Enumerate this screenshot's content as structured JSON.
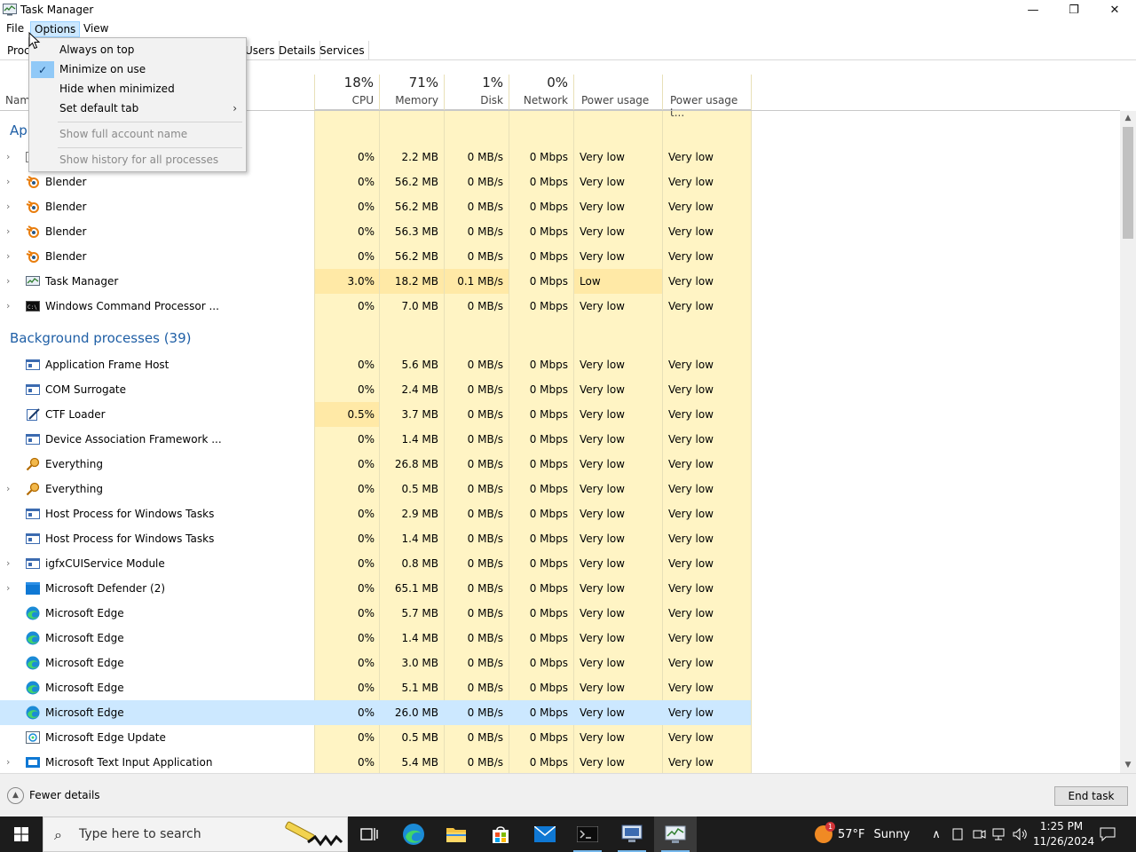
{
  "window": {
    "title": "Task Manager",
    "controls": {
      "minimize": "—",
      "maximize": "❐",
      "close": "✕"
    }
  },
  "menubar": {
    "file": "File",
    "options": "Options",
    "view": "View"
  },
  "tabs": {
    "processes": "Proc",
    "users": "Users",
    "details": "Details",
    "services": "Services"
  },
  "columns": {
    "name": "Nam",
    "cpu": {
      "pct": "18%",
      "label": "CPU"
    },
    "memory": {
      "pct": "71%",
      "label": "Memory"
    },
    "disk": {
      "pct": "1%",
      "label": "Disk"
    },
    "network": {
      "pct": "0%",
      "label": "Network"
    },
    "power": {
      "label": "Power usage"
    },
    "power_trend": {
      "label": "Power usage t..."
    }
  },
  "groups": {
    "apps": "App",
    "background": "Background processes (39)"
  },
  "apps_rows": [
    {
      "name": "",
      "icon": "app-icon",
      "expander": true,
      "cpu": "0%",
      "mem": "2.2 MB",
      "disk": "0 MB/s",
      "net": "0 Mbps",
      "power": "Very low",
      "trend": "Very low"
    },
    {
      "name": "Blender",
      "icon": "blender-icon",
      "expander": true,
      "cpu": "0%",
      "mem": "56.2 MB",
      "disk": "0 MB/s",
      "net": "0 Mbps",
      "power": "Very low",
      "trend": "Very low"
    },
    {
      "name": "Blender",
      "icon": "blender-icon",
      "expander": true,
      "cpu": "0%",
      "mem": "56.2 MB",
      "disk": "0 MB/s",
      "net": "0 Mbps",
      "power": "Very low",
      "trend": "Very low"
    },
    {
      "name": "Blender",
      "icon": "blender-icon",
      "expander": true,
      "cpu": "0%",
      "mem": "56.3 MB",
      "disk": "0 MB/s",
      "net": "0 Mbps",
      "power": "Very low",
      "trend": "Very low"
    },
    {
      "name": "Blender",
      "icon": "blender-icon",
      "expander": true,
      "cpu": "0%",
      "mem": "56.2 MB",
      "disk": "0 MB/s",
      "net": "0 Mbps",
      "power": "Very low",
      "trend": "Very low"
    },
    {
      "name": "Task Manager",
      "icon": "task-manager-icon",
      "expander": true,
      "cpu": "3.0%",
      "mem": "18.2 MB",
      "disk": "0.1 MB/s",
      "net": "0 Mbps",
      "power": "Low",
      "trend": "Very low",
      "hot": true
    },
    {
      "name": "Windows Command Processor ...",
      "icon": "cmd-icon",
      "expander": true,
      "cpu": "0%",
      "mem": "7.0 MB",
      "disk": "0 MB/s",
      "net": "0 Mbps",
      "power": "Very low",
      "trend": "Very low"
    }
  ],
  "bg_rows": [
    {
      "name": "Application Frame Host",
      "icon": "window-icon",
      "expander": false,
      "cpu": "0%",
      "mem": "5.6 MB",
      "disk": "0 MB/s",
      "net": "0 Mbps",
      "power": "Very low",
      "trend": "Very low"
    },
    {
      "name": "COM Surrogate",
      "icon": "window-icon",
      "expander": false,
      "cpu": "0%",
      "mem": "2.4 MB",
      "disk": "0 MB/s",
      "net": "0 Mbps",
      "power": "Very low",
      "trend": "Very low"
    },
    {
      "name": "CTF Loader",
      "icon": "ctf-icon",
      "expander": false,
      "cpu": "0.5%",
      "mem": "3.7 MB",
      "disk": "0 MB/s",
      "net": "0 Mbps",
      "power": "Very low",
      "trend": "Very low",
      "cpuhot": true
    },
    {
      "name": "Device Association Framework ...",
      "icon": "window-icon",
      "expander": false,
      "cpu": "0%",
      "mem": "1.4 MB",
      "disk": "0 MB/s",
      "net": "0 Mbps",
      "power": "Very low",
      "trend": "Very low"
    },
    {
      "name": "Everything",
      "icon": "everything-icon",
      "expander": false,
      "cpu": "0%",
      "mem": "26.8 MB",
      "disk": "0 MB/s",
      "net": "0 Mbps",
      "power": "Very low",
      "trend": "Very low"
    },
    {
      "name": "Everything",
      "icon": "everything-icon",
      "expander": true,
      "cpu": "0%",
      "mem": "0.5 MB",
      "disk": "0 MB/s",
      "net": "0 Mbps",
      "power": "Very low",
      "trend": "Very low"
    },
    {
      "name": "Host Process for Windows Tasks",
      "icon": "window-icon",
      "expander": false,
      "cpu": "0%",
      "mem": "2.9 MB",
      "disk": "0 MB/s",
      "net": "0 Mbps",
      "power": "Very low",
      "trend": "Very low"
    },
    {
      "name": "Host Process for Windows Tasks",
      "icon": "window-icon",
      "expander": false,
      "cpu": "0%",
      "mem": "1.4 MB",
      "disk": "0 MB/s",
      "net": "0 Mbps",
      "power": "Very low",
      "trend": "Very low"
    },
    {
      "name": "igfxCUIService Module",
      "icon": "window-icon",
      "expander": true,
      "cpu": "0%",
      "mem": "0.8 MB",
      "disk": "0 MB/s",
      "net": "0 Mbps",
      "power": "Very low",
      "trend": "Very low"
    },
    {
      "name": "Microsoft Defender (2)",
      "icon": "defender-icon",
      "expander": true,
      "cpu": "0%",
      "mem": "65.1 MB",
      "disk": "0 MB/s",
      "net": "0 Mbps",
      "power": "Very low",
      "trend": "Very low"
    },
    {
      "name": "Microsoft Edge",
      "icon": "edge-icon",
      "expander": false,
      "cpu": "0%",
      "mem": "5.7 MB",
      "disk": "0 MB/s",
      "net": "0 Mbps",
      "power": "Very low",
      "trend": "Very low"
    },
    {
      "name": "Microsoft Edge",
      "icon": "edge-icon",
      "expander": false,
      "cpu": "0%",
      "mem": "1.4 MB",
      "disk": "0 MB/s",
      "net": "0 Mbps",
      "power": "Very low",
      "trend": "Very low"
    },
    {
      "name": "Microsoft Edge",
      "icon": "edge-icon",
      "expander": false,
      "cpu": "0%",
      "mem": "3.0 MB",
      "disk": "0 MB/s",
      "net": "0 Mbps",
      "power": "Very low",
      "trend": "Very low"
    },
    {
      "name": "Microsoft Edge",
      "icon": "edge-icon",
      "expander": false,
      "cpu": "0%",
      "mem": "5.1 MB",
      "disk": "0 MB/s",
      "net": "0 Mbps",
      "power": "Very low",
      "trend": "Very low"
    },
    {
      "name": "Microsoft Edge",
      "icon": "edge-icon",
      "expander": false,
      "cpu": "0%",
      "mem": "26.0 MB",
      "disk": "0 MB/s",
      "net": "0 Mbps",
      "power": "Very low",
      "trend": "Very low",
      "selected": true
    },
    {
      "name": "Microsoft Edge Update",
      "icon": "edge-update-icon",
      "expander": false,
      "cpu": "0%",
      "mem": "0.5 MB",
      "disk": "0 MB/s",
      "net": "0 Mbps",
      "power": "Very low",
      "trend": "Very low"
    },
    {
      "name": "Microsoft Text Input Application",
      "icon": "text-input-icon",
      "expander": true,
      "cpu": "0%",
      "mem": "5.4 MB",
      "disk": "0 MB/s",
      "net": "0 Mbps",
      "power": "Very low",
      "trend": "Very low"
    }
  ],
  "options_menu": {
    "always_on_top": "Always on top",
    "minimize_on_use": "Minimize on use",
    "hide_when_minimized": "Hide when minimized",
    "set_default_tab": "Set default tab",
    "show_full_account_name": "Show full account name",
    "show_history": "Show history for all processes",
    "checked": "✓",
    "submenu_arrow": "›"
  },
  "footer": {
    "fewer_details": "Fewer details",
    "end_task": "End task"
  },
  "taskbar": {
    "search_placeholder": "Type here to search",
    "weather_temp": "57°F",
    "weather_cond": "Sunny",
    "weather_badge": "1",
    "time": "1:25 PM",
    "date": "11/26/2024"
  },
  "colors": {
    "heat_low": "#fff4c4",
    "heat_med": "#ffe9a6",
    "selection": "#cce8ff",
    "group_header": "#1f5fa6",
    "taskbar": "#1c1c1c"
  }
}
